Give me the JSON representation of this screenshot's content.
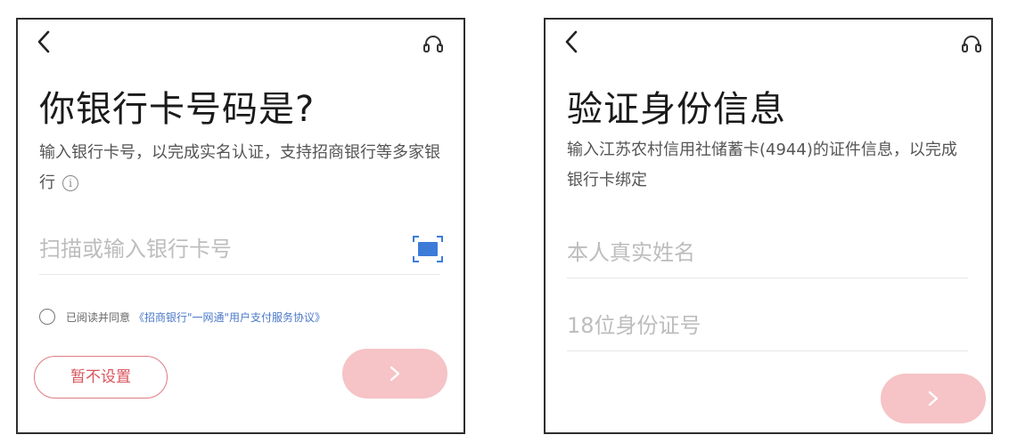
{
  "left_screen": {
    "title": "你银行卡号码是?",
    "subtitle": "输入银行卡号，以完成实名认证，支持招商银行等多家银行",
    "card_input": {
      "placeholder": "扫描或输入银行卡号",
      "value": ""
    },
    "agreement": {
      "text": "已阅读并同意",
      "link": "《招商银行\"一网通\"用户支付服务协议》"
    },
    "skip_label": "暂不设置"
  },
  "right_screen": {
    "title": "验证身份信息",
    "subtitle": "输入江苏农村信用社储蓄卡(4944)的证件信息，以完成银行卡绑定",
    "name_input": {
      "placeholder": "本人真实姓名",
      "value": ""
    },
    "id_input": {
      "placeholder": "18位身份证号",
      "value": ""
    }
  },
  "icons": {
    "back": "chevron-left-icon",
    "support": "headset-icon",
    "info": "info-circle-icon",
    "scan": "card-scan-icon",
    "next": "chevron-right-icon"
  },
  "colors": {
    "accent": "#d9555c",
    "next_button": "#f6c3c6",
    "link": "#4a78c8",
    "scan_icon": "#3d7bd9"
  }
}
